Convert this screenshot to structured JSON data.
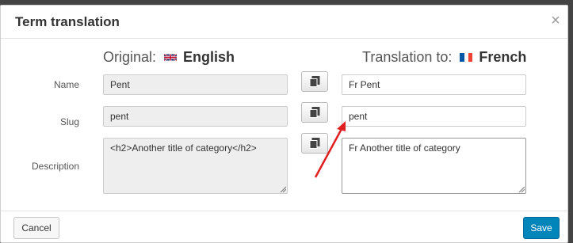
{
  "dialog": {
    "title": "Term translation",
    "close_icon": "close-icon"
  },
  "original": {
    "prefix": "Original:",
    "language": "English",
    "flag": "uk-flag-icon"
  },
  "translation": {
    "prefix": "Translation to:",
    "language": "French",
    "flag": "france-flag-icon"
  },
  "rows": {
    "name": {
      "label": "Name",
      "original_value": "Pent",
      "translation_value": "Fr Pent"
    },
    "slug": {
      "label": "Slug",
      "original_value": "pent",
      "translation_value": "pent"
    },
    "description": {
      "label": "Description",
      "original_value": "<h2>Another title of category</h2>",
      "translation_value": "Fr Another title of category"
    }
  },
  "copy_icon": "copy-icon",
  "annotation": {
    "color": "#e02020",
    "icon": "red-arrow-icon"
  },
  "footer": {
    "cancel_label": "Cancel",
    "save_label": "Save",
    "save_color": "#0085ba"
  }
}
